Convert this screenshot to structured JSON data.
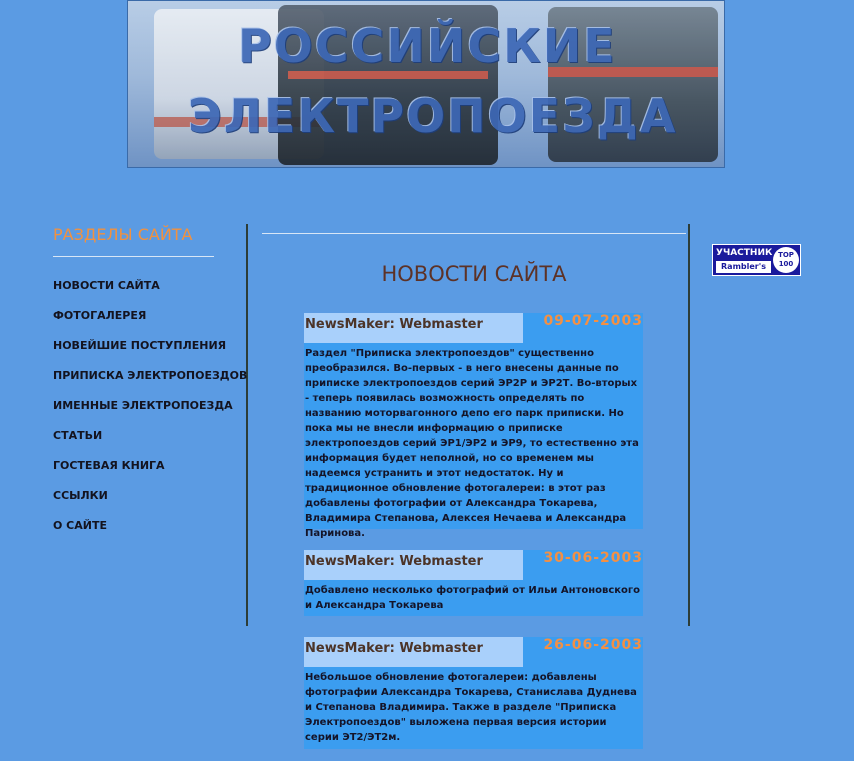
{
  "banner": {
    "title_line1": "РОССИЙСКИЕ",
    "title_line2": "ЭЛЕКТРОПОЕЗДА"
  },
  "sidebar": {
    "title": "РАЗДЕЛЫ САЙТА",
    "items": [
      {
        "label": "НОВОСТИ САЙТА"
      },
      {
        "label": "ФОТОГАЛЕРЕЯ"
      },
      {
        "label": "НОВЕЙШИЕ ПОСТУПЛЕНИЯ"
      },
      {
        "label": "ПРИПИСКА ЭЛЕКТРОПОЕЗДОВ"
      },
      {
        "label": "ИМЕННЫЕ ЭЛЕКТРОПОЕЗДА"
      },
      {
        "label": "СТАТЬИ"
      },
      {
        "label": "ГОСТЕВАЯ КНИГА"
      },
      {
        "label": "ССЫЛКИ"
      },
      {
        "label": "О САЙТЕ"
      }
    ]
  },
  "main": {
    "heading": "НОВОСТИ САЙТА",
    "news": [
      {
        "author": "NewsMaker: Webmaster",
        "date": "09-07-2003",
        "text": "Раздел \"Приписка электропоездов\" существенно преобразился. Во-первых - в него внесены данные по приписке электропоездов серий ЭР2Р и ЭР2Т. Во-вторых - теперь появилась возможность определять по названию моторвагонного депо его парк приписки. Но пока мы не внесли информацию о приписке электропоездов серий ЭР1/ЭР2 и ЭР9, то естественно эта информация будет неполной, но со временем мы надеемся устранить и этот недостаток. Ну и традиционное обновление фотогалереи: в этот раз добавлены фотографии от Александра Токарева, Владимира Степанова, Алексея Нечаева и Александра Паринова."
      },
      {
        "author": "NewsMaker: Webmaster",
        "date": "30-06-2003",
        "text": "Добавлено несколько фотографий от Ильи Антоновского и Александра Токарева"
      },
      {
        "author": "NewsMaker: Webmaster",
        "date": "26-06-2003",
        "text": "Небольшое обновление фотогалереи: добавлены фотографии Александра Токарева, Станислава Дуднева и Степанова Владимира. Также в разделе \"Приписка Электропоездов\" выложена первая версия истории серии ЭТ2/ЭТ2м."
      }
    ]
  },
  "rambler": {
    "top_text": "УЧАСТНИК",
    "bottom_text": "Rambler's",
    "circle_line1": "TOP",
    "circle_line2": "100"
  },
  "colors": {
    "page_bg": "#5b9be3",
    "accent_orange": "#f2913e",
    "news_author_bg": "#a9d0fb",
    "news_body_bg": "#3b9df0",
    "heading_brown": "#5d3226"
  }
}
